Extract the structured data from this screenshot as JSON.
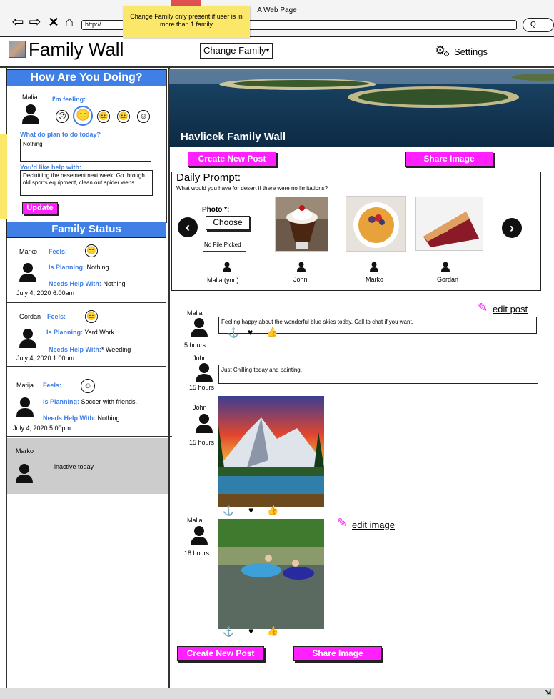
{
  "browser": {
    "page_title": "A Web Page",
    "url": "http://",
    "search_glyph": "Q"
  },
  "annotation": {
    "note": "Change Family only present if user is in more than 1 family"
  },
  "header": {
    "app_title": "Family Wall",
    "family_select": "Change Family",
    "settings_label": "Settings"
  },
  "sidebar": {
    "how_title": "How Are You Doing?",
    "user_name": "Malia",
    "feeling_label": "I'm feeling:",
    "plan_label": "What do plan to do today?",
    "plan_value": "Nothing",
    "help_label": "You'd like help with:",
    "help_value": "Decluttling the basement next week. Go through old sports equipment, clean out spider webs.",
    "update_label": "Update",
    "status_title": "Family Status",
    "members": [
      {
        "name": "Marko",
        "feels": "Feels:",
        "planning_label": "Is Planning:",
        "planning": "Nothing",
        "help_label": "Needs Help With:",
        "help": "Nothing",
        "time": "July 4, 2020 6:00am"
      },
      {
        "name": "Gordan",
        "feels": "Feels:",
        "planning_label": "Is Planning:",
        "planning": "Yard Work.",
        "help_label": "Needs Help With:",
        "help": "* Weeding",
        "time": "July 4, 2020 1:00pm"
      },
      {
        "name": "Matija",
        "feels": "Feels:",
        "planning_label": "Is Planning:",
        "planning": "Soccer with friends.",
        "help_label": "Needs Help With:",
        "help": "Nothing",
        "time": "July 4, 2020 5:00pm"
      }
    ],
    "inactive_name": "Marko",
    "inactive_text": "inactive today"
  },
  "main": {
    "banner_title": "Havlicek Family Wall",
    "create_post": "Create New Post",
    "share_image": "Share Image",
    "prompt_title": "Daily Prompt:",
    "prompt_question": "What would you have for desert if there were no limitations?",
    "photo_label": "Photo *:",
    "choose_label": "Choose",
    "no_file": "No File Picked",
    "responders": [
      "Malia (you)",
      "John",
      "Marko",
      "Gordan"
    ],
    "posts": [
      {
        "author": "Malia",
        "age": "5 hours",
        "text": "Feeling happy about the wonderful blue skies today. Call to chat if you want.",
        "edit": "edit post"
      },
      {
        "author": "John",
        "age": "15 hours",
        "text": "Just Chilling today and painting."
      },
      {
        "author": "John",
        "age": "15 hours"
      },
      {
        "author": "Malia",
        "age": "18 hours",
        "edit": "edit image"
      }
    ]
  },
  "colors": {
    "accent_blue": "#3f7fe6",
    "button_magenta": "#ff1fff",
    "note_yellow": "#fbe76a"
  },
  "icons": [
    "back-arrow-icon",
    "forward-arrow-icon",
    "close-icon",
    "home-icon",
    "search-icon",
    "gear-icon",
    "person-icon",
    "smiley-icon",
    "pencil-icon",
    "anchor-icon",
    "heart-icon",
    "thumbs-up-icon",
    "chevron-left-icon",
    "chevron-right-icon"
  ]
}
